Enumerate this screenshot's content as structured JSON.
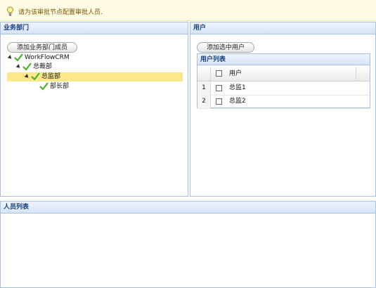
{
  "notice": {
    "text": "请为该审批节点配置审批人员."
  },
  "dept_panel": {
    "title": "业务部门",
    "add_button": "添加业务部门成员",
    "tree": [
      {
        "label": "WorkFlowCRM",
        "level": 0,
        "expanded": true,
        "selected": false
      },
      {
        "label": "总裁部",
        "level": 1,
        "expanded": true,
        "selected": false
      },
      {
        "label": "总监部",
        "level": 2,
        "expanded": true,
        "selected": true
      },
      {
        "label": "部长部",
        "level": 3,
        "expanded": false,
        "selected": false
      }
    ]
  },
  "user_panel": {
    "title": "用户",
    "add_button": "添加选中用户",
    "grid": {
      "title": "用户列表",
      "column": "用户",
      "rows": [
        {
          "num": "1",
          "name": "总监1"
        },
        {
          "num": "2",
          "name": "总监2"
        }
      ]
    }
  },
  "people_panel": {
    "title": "人员列表"
  },
  "colors": {
    "header_text": "#153e7e",
    "border": "#a6c1e0",
    "selected_bg": "#fbe88c",
    "check": "#4caf2c"
  },
  "icons": {
    "notice": "lightbulb-icon",
    "tree_node": "checkmark-icon",
    "expander": "triangle-down-icon"
  }
}
